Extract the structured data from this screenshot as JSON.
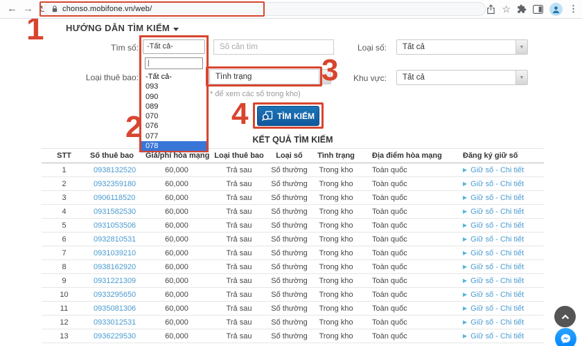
{
  "browser": {
    "url": "chonso.mobifone.vn/web/"
  },
  "annotations": {
    "step1": "1",
    "step2": "2",
    "step3": "3",
    "step4": "4"
  },
  "page": {
    "heading": "HƯỚNG DẪN TÌM KIẾM",
    "form": {
      "tim_so_label": "Tìm số:",
      "so_can_tim_placeholder": "Số cần tìm",
      "loai_so_label": "Loại số:",
      "loai_so_value": "Tất cả",
      "loai_thue_bao_label": "Loại thuê bao:",
      "tinh_trang_value": "Tình trạng",
      "khu_vuc_label": "Khu vực:",
      "khu_vuc_value": "Tất cả",
      "note": "* để xem các số trong kho)",
      "search_button_label": "TÌM KIẾM"
    },
    "dropdown": {
      "display_value": "-Tất cả-",
      "search_value": "",
      "options": [
        "-Tất cả-",
        "093",
        "090",
        "089",
        "070",
        "076",
        "077",
        "078"
      ],
      "selected_index": 7
    },
    "results": {
      "title": "KẾT QUẢ TÌM KIẾM",
      "columns": [
        "STT",
        "Số thuê bao",
        "Giá/phí hòa mạng",
        "Loại thuê bao",
        "Loại số",
        "Tình trạng",
        "Địa điểm hòa mạng",
        "Đăng ký giữ số"
      ],
      "rows": [
        {
          "stt": "1",
          "phone": "0938132520",
          "price": "60,000",
          "subscriber_type": "Trả sau",
          "number_type": "Số thường",
          "status": "Trong kho",
          "region": "Toàn quốc",
          "action": "Giữ số - Chi tiết"
        },
        {
          "stt": "2",
          "phone": "0932359180",
          "price": "60,000",
          "subscriber_type": "Trả sau",
          "number_type": "Số thường",
          "status": "Trong kho",
          "region": "Toàn quốc",
          "action": "Giữ số - Chi tiết"
        },
        {
          "stt": "3",
          "phone": "0906118520",
          "price": "60,000",
          "subscriber_type": "Trả sau",
          "number_type": "Số thường",
          "status": "Trong kho",
          "region": "Toàn quốc",
          "action": "Giữ số - Chi tiết"
        },
        {
          "stt": "4",
          "phone": "0931582530",
          "price": "60,000",
          "subscriber_type": "Trả sau",
          "number_type": "Số thường",
          "status": "Trong kho",
          "region": "Toàn quốc",
          "action": "Giữ số - Chi tiết"
        },
        {
          "stt": "5",
          "phone": "0931053506",
          "price": "60,000",
          "subscriber_type": "Trả sau",
          "number_type": "Số thường",
          "status": "Trong kho",
          "region": "Toàn quốc",
          "action": "Giữ số - Chi tiết"
        },
        {
          "stt": "6",
          "phone": "0932810531",
          "price": "60,000",
          "subscriber_type": "Trả sau",
          "number_type": "Số thường",
          "status": "Trong kho",
          "region": "Toàn quốc",
          "action": "Giữ số - Chi tiết"
        },
        {
          "stt": "7",
          "phone": "0931039210",
          "price": "60,000",
          "subscriber_type": "Trả sau",
          "number_type": "Số thường",
          "status": "Trong kho",
          "region": "Toàn quốc",
          "action": "Giữ số - Chi tiết"
        },
        {
          "stt": "8",
          "phone": "0938162920",
          "price": "60,000",
          "subscriber_type": "Trả sau",
          "number_type": "Số thường",
          "status": "Trong kho",
          "region": "Toàn quốc",
          "action": "Giữ số - Chi tiết"
        },
        {
          "stt": "9",
          "phone": "0931221309",
          "price": "60,000",
          "subscriber_type": "Trả sau",
          "number_type": "Số thường",
          "status": "Trong kho",
          "region": "Toàn quốc",
          "action": "Giữ số - Chi tiết"
        },
        {
          "stt": "10",
          "phone": "0933295650",
          "price": "60,000",
          "subscriber_type": "Trả sau",
          "number_type": "Số thường",
          "status": "Trong kho",
          "region": "Toàn quốc",
          "action": "Giữ số - Chi tiết"
        },
        {
          "stt": "11",
          "phone": "0935081306",
          "price": "60,000",
          "subscriber_type": "Trả sau",
          "number_type": "Số thường",
          "status": "Trong kho",
          "region": "Toàn quốc",
          "action": "Giữ số - Chi tiết"
        },
        {
          "stt": "12",
          "phone": "0933012531",
          "price": "60,000",
          "subscriber_type": "Trả sau",
          "number_type": "Số thường",
          "status": "Trong kho",
          "region": "Toàn quốc",
          "action": "Giữ số - Chi tiết"
        },
        {
          "stt": "13",
          "phone": "0936229530",
          "price": "60,000",
          "subscriber_type": "Trả sau",
          "number_type": "Số thường",
          "status": "Trong kho",
          "region": "Toàn quốc",
          "action": "Giữ số - Chi tiết"
        }
      ]
    }
  },
  "colors": {
    "annotation_red": "#d8452f",
    "button_blue": "#11589d",
    "link_blue": "#4a9bd0",
    "selected_option_blue": "#3875d7",
    "messenger_blue": "#0084ff"
  }
}
